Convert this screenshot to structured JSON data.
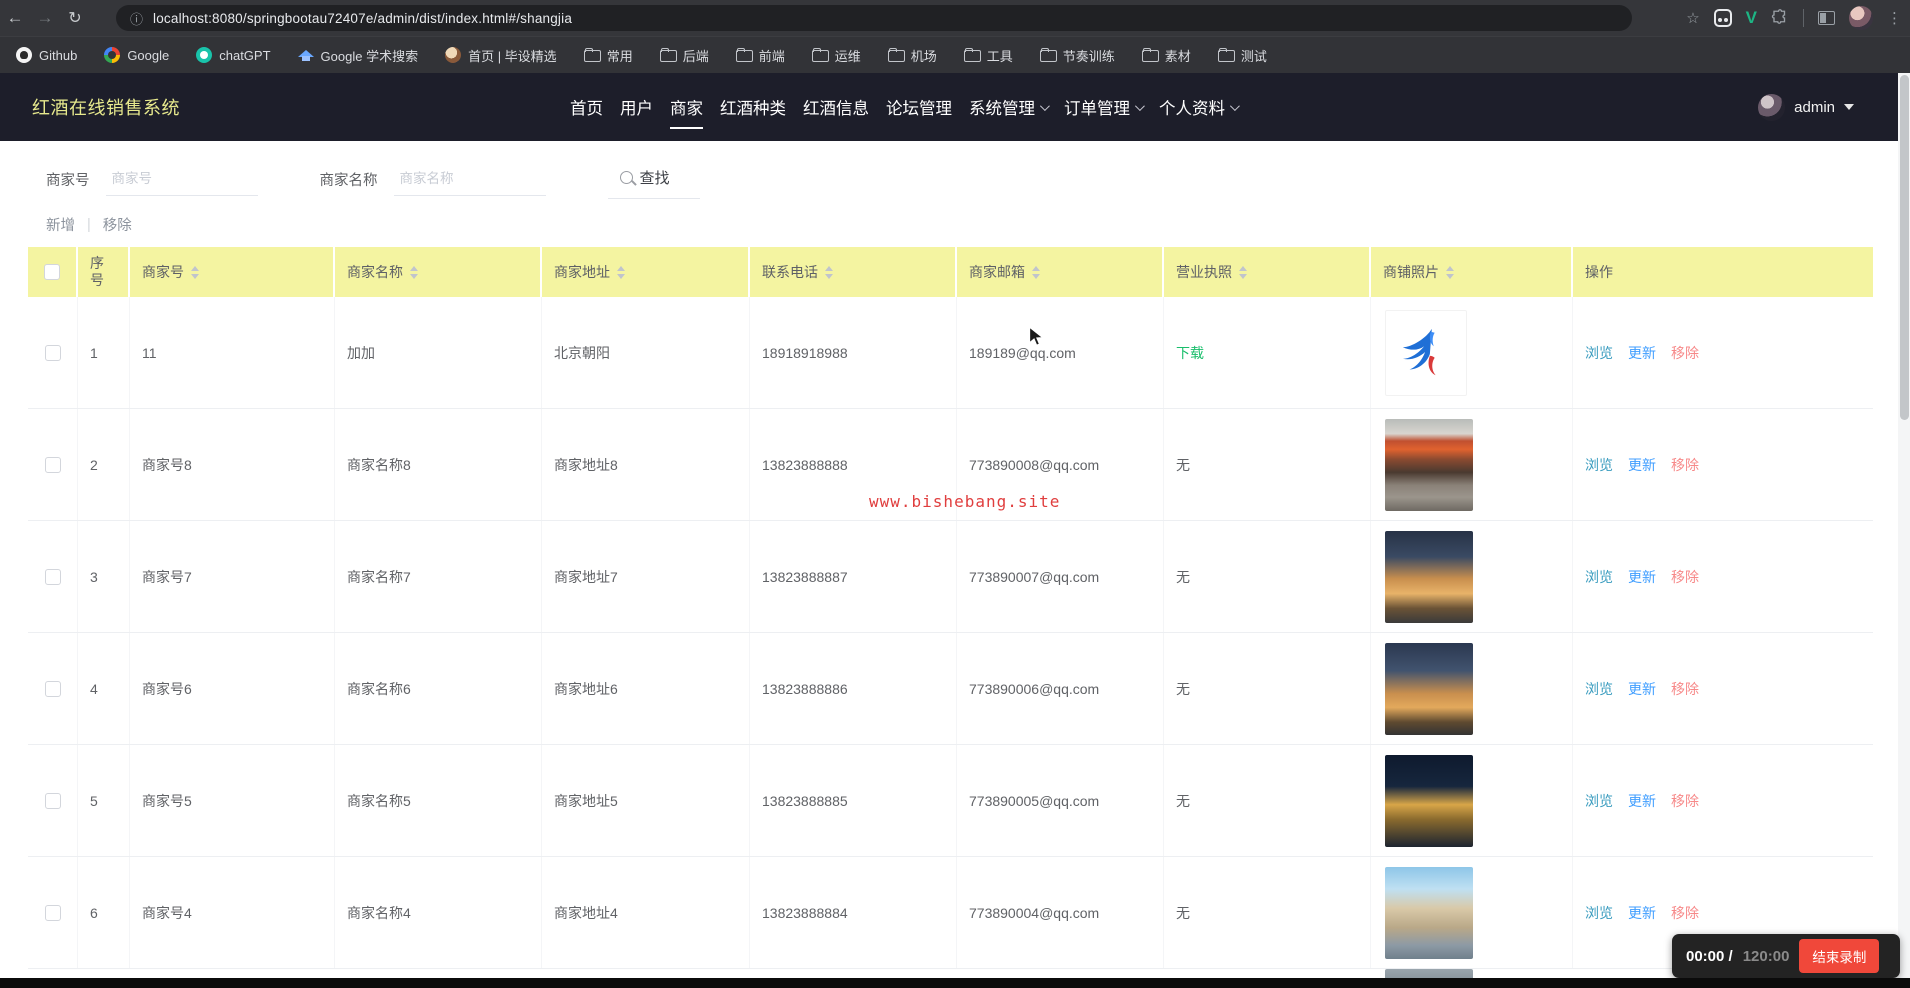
{
  "browser": {
    "url": "localhost:8080/springbootau72407e/admin/dist/index.html#/shangjia",
    "bookmarks": [
      {
        "label": "Github",
        "icon": "github"
      },
      {
        "label": "Google",
        "icon": "google"
      },
      {
        "label": "chatGPT",
        "icon": "chatgpt"
      },
      {
        "label": "Google 学术搜索",
        "icon": "scholar"
      },
      {
        "label": "首页 | 毕设精选",
        "icon": "home"
      },
      {
        "label": "常用",
        "icon": "folder"
      },
      {
        "label": "后端",
        "icon": "folder"
      },
      {
        "label": "前端",
        "icon": "folder"
      },
      {
        "label": "运维",
        "icon": "folder"
      },
      {
        "label": "机场",
        "icon": "folder"
      },
      {
        "label": "工具",
        "icon": "folder"
      },
      {
        "label": "节奏训练",
        "icon": "folder"
      },
      {
        "label": "素材",
        "icon": "folder"
      },
      {
        "label": "测试",
        "icon": "folder"
      }
    ]
  },
  "navbar": {
    "brand": "红酒在线销售系统",
    "items": [
      {
        "label": "首页"
      },
      {
        "label": "用户"
      },
      {
        "label": "商家",
        "active": true
      },
      {
        "label": "红酒种类"
      },
      {
        "label": "红酒信息"
      },
      {
        "label": "论坛管理"
      },
      {
        "label": "系统管理",
        "caret": true
      },
      {
        "label": "订单管理",
        "caret": true
      },
      {
        "label": "个人资料",
        "caret": true
      }
    ],
    "user": "admin"
  },
  "search": {
    "code_label": "商家号",
    "code_placeholder": "商家号",
    "code_value": "",
    "name_label": "商家名称",
    "name_placeholder": "商家名称",
    "name_value": "",
    "button_label": "查找"
  },
  "actions_bar": {
    "add": "新增",
    "separator": "|",
    "remove": "移除"
  },
  "table": {
    "headers": {
      "no": "序号",
      "code": "商家号",
      "name": "商家名称",
      "address": "商家地址",
      "phone": "联系电话",
      "email": "商家邮箱",
      "license": "营业执照",
      "photo": "商铺照片",
      "op": "操作"
    },
    "row_actions": {
      "view": "浏览",
      "update": "更新",
      "remove": "移除"
    },
    "rows": [
      {
        "no": "1",
        "code": "11",
        "name": "加加",
        "address": "北京朝阳",
        "phone": "18918918988",
        "email": "189189@qq.com",
        "license": "下载",
        "license_is_link": true,
        "photo": "bird-logo"
      },
      {
        "no": "2",
        "code": "商家号8",
        "name": "商家名称8",
        "address": "商家地址8",
        "phone": "13823888888",
        "email": "773890008@qq.com",
        "license": "无",
        "license_is_link": false,
        "photo": "storefront-day"
      },
      {
        "no": "3",
        "code": "商家号7",
        "name": "商家名称7",
        "address": "商家地址7",
        "phone": "13823888887",
        "email": "773890007@qq.com",
        "license": "无",
        "license_is_link": false,
        "photo": "mall-dusk"
      },
      {
        "no": "4",
        "code": "商家号6",
        "name": "商家名称6",
        "address": "商家地址6",
        "phone": "13823888886",
        "email": "773890006@qq.com",
        "license": "无",
        "license_is_link": false,
        "photo": "mall-dusk"
      },
      {
        "no": "5",
        "code": "商家号5",
        "name": "商家名称5",
        "address": "商家地址5",
        "phone": "13823888885",
        "email": "773890005@qq.com",
        "license": "无",
        "license_is_link": false,
        "photo": "night-street"
      },
      {
        "no": "6",
        "code": "商家号4",
        "name": "商家名称4",
        "address": "商家地址4",
        "phone": "13823888884",
        "email": "773890004@qq.com",
        "license": "无",
        "license_is_link": false,
        "photo": "plaza-day"
      }
    ]
  },
  "watermark": "www.bishebang.site",
  "recorder": {
    "elapsed": "00:00 /",
    "total": "120:00",
    "stop_label": "结束录制"
  },
  "colors": {
    "table_header_yellow": "#f4f4a1",
    "brand_yellow": "#e7e98d",
    "link_view": "#3a9cbf",
    "link_update": "#409eff",
    "link_remove": "#f78989",
    "license_download_green": "#19be6b",
    "watermark_red": "#e03e3e",
    "record_button_red": "#f0483a"
  }
}
